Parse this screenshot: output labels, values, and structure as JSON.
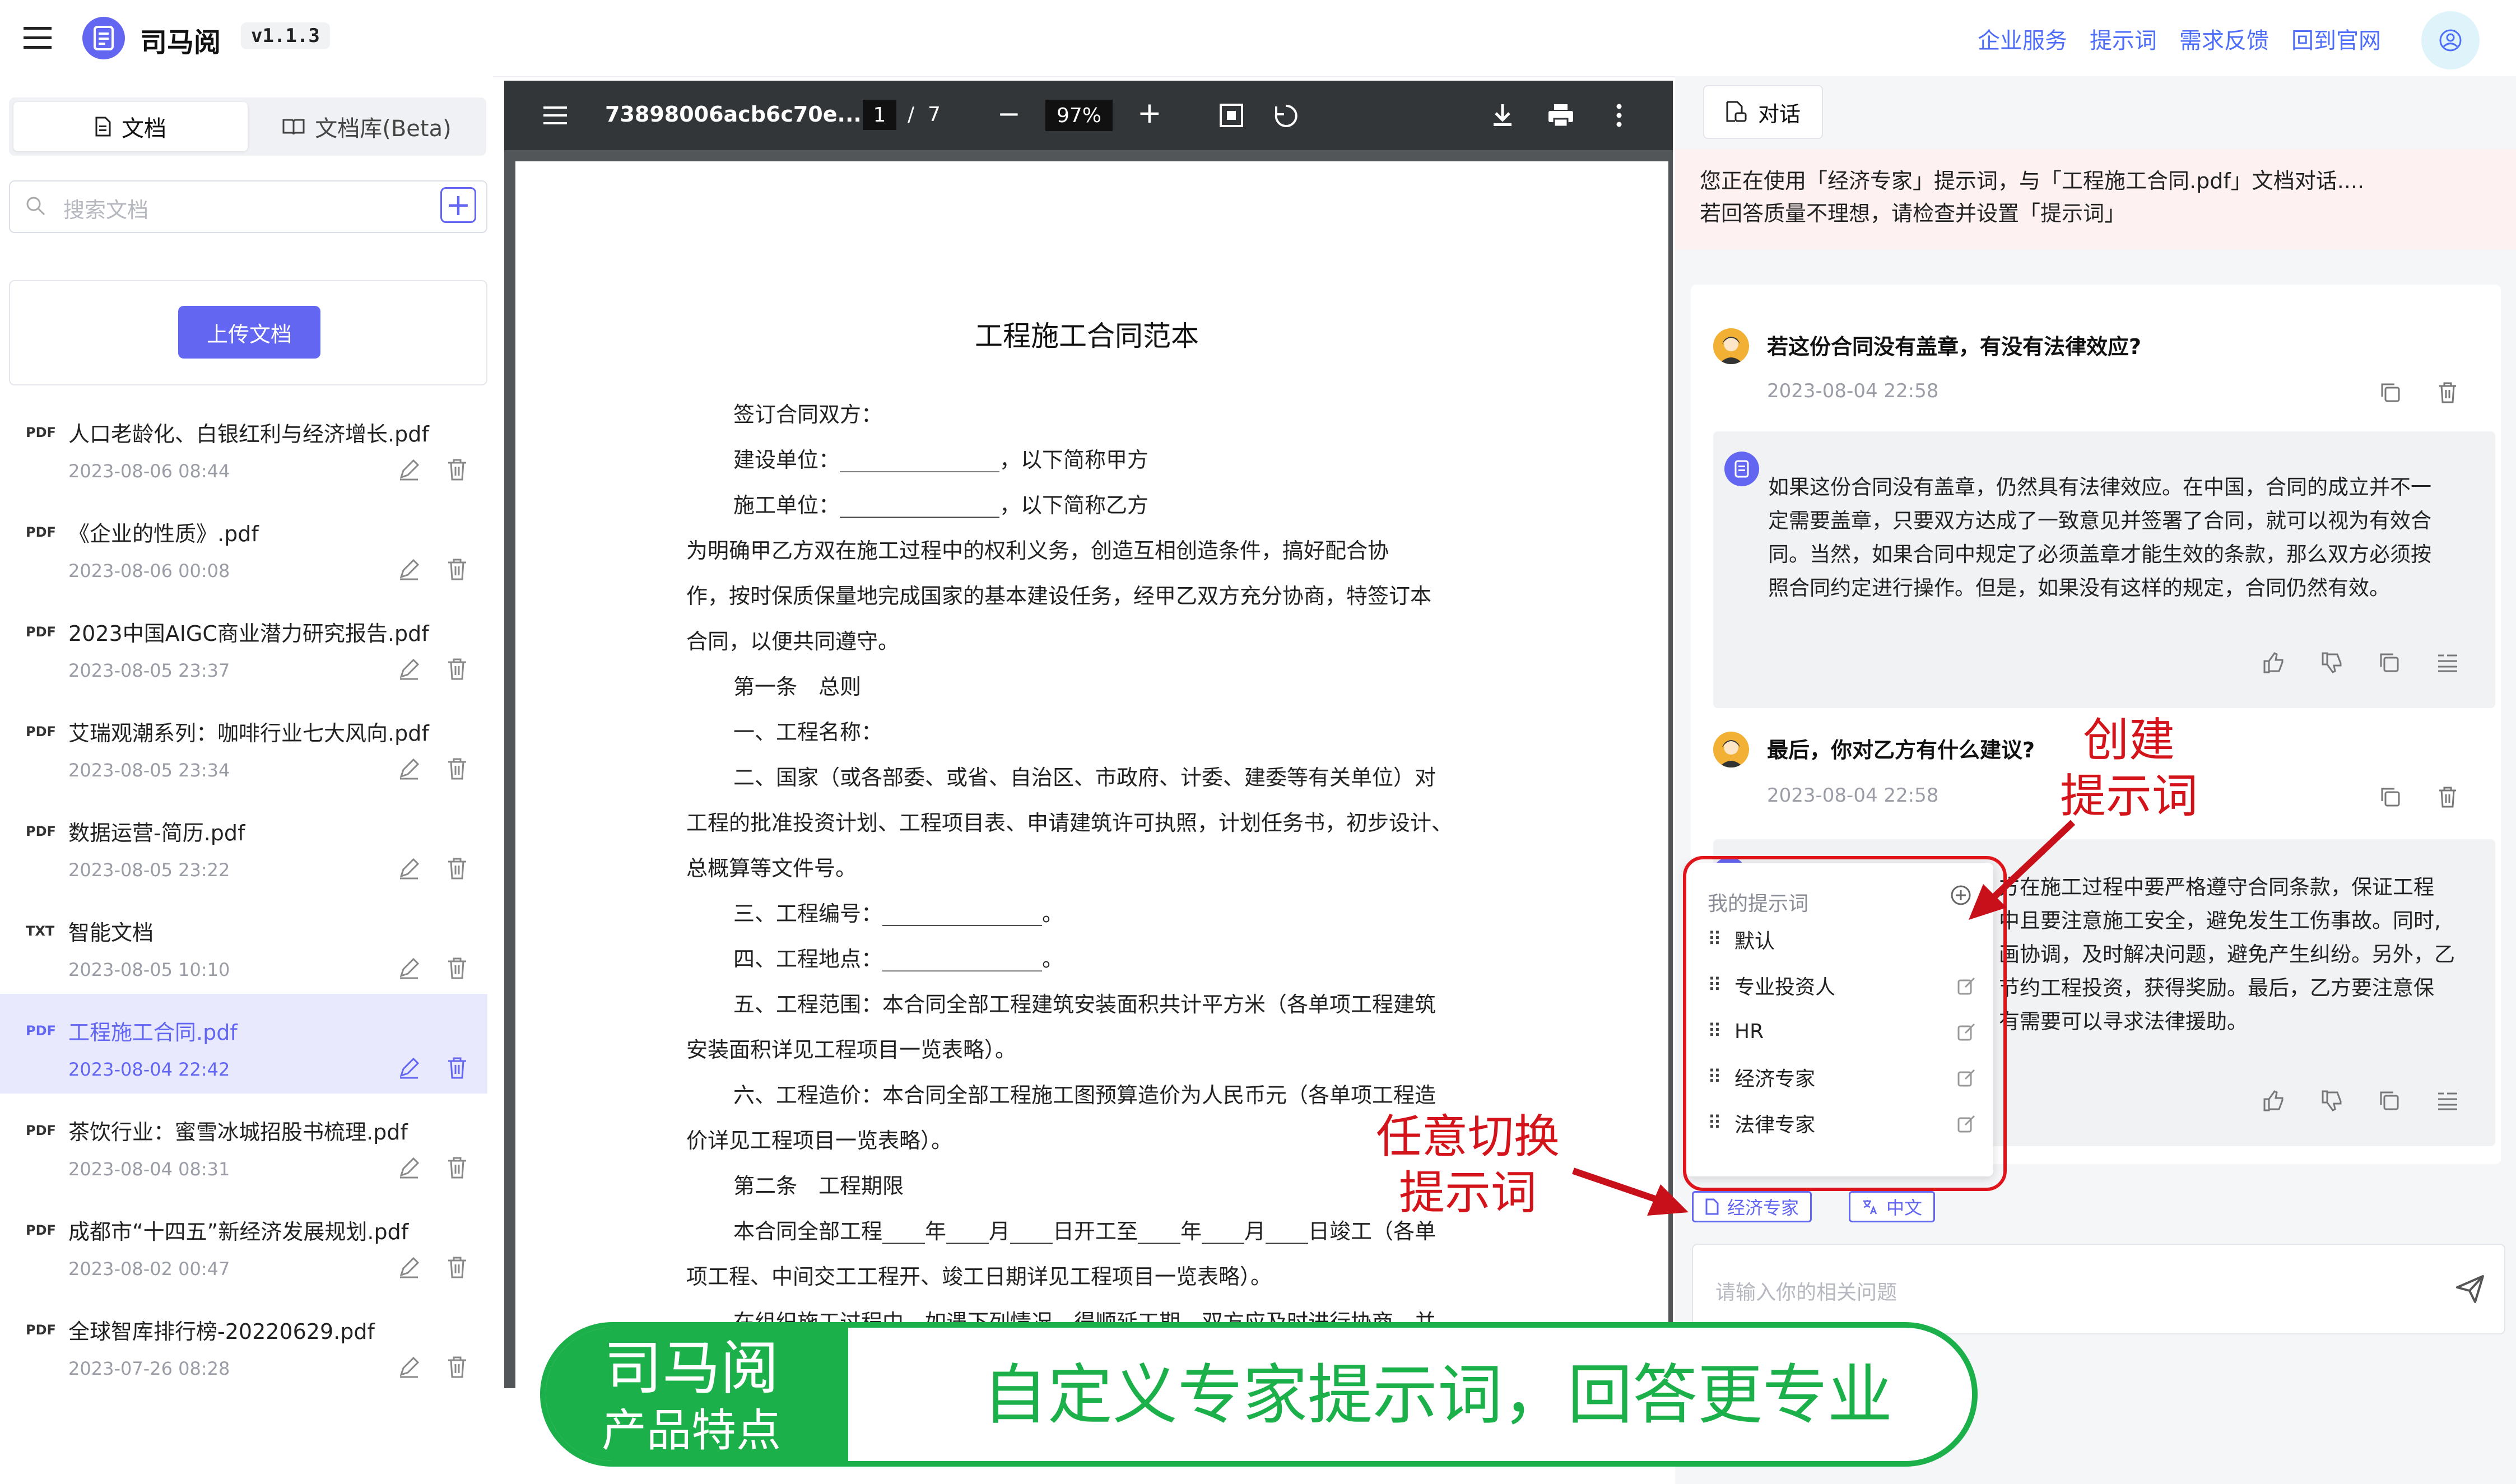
{
  "header": {
    "app_title": "司马阅",
    "version": "v1.1.3",
    "nav": [
      "企业服务",
      "提示词",
      "需求反馈",
      "回到官网"
    ]
  },
  "sidebar": {
    "tabs": [
      {
        "label": "文档",
        "active": true
      },
      {
        "label": "文档库(Beta)",
        "active": false
      }
    ],
    "search_placeholder": "搜索文档",
    "add_label": "+",
    "upload_label": "上传文档",
    "files": [
      {
        "type": "PDF",
        "name": "人口老龄化、白银红利与经济增长.pdf",
        "date": "2023-08-06 08:44",
        "active": false
      },
      {
        "type": "PDF",
        "name": "《企业的性质》.pdf",
        "date": "2023-08-06 00:08",
        "active": false
      },
      {
        "type": "PDF",
        "name": "2023中国AIGC商业潜力研究报告.pdf",
        "date": "2023-08-05 23:37",
        "active": false
      },
      {
        "type": "PDF",
        "name": "艾瑞观潮系列：咖啡行业七大风向.pdf",
        "date": "2023-08-05 23:34",
        "active": false
      },
      {
        "type": "PDF",
        "name": "数据运营-简历.pdf",
        "date": "2023-08-05 23:22",
        "active": false
      },
      {
        "type": "TXT",
        "name": "智能文档",
        "date": "2023-08-05 10:10",
        "active": false
      },
      {
        "type": "PDF",
        "name": "工程施工合同.pdf",
        "date": "2023-08-04 22:42",
        "active": true
      },
      {
        "type": "PDF",
        "name": "茶饮行业：蜜雪冰城招股书梳理.pdf",
        "date": "2023-08-04 08:31",
        "active": false
      },
      {
        "type": "PDF",
        "name": "成都市“十四五”新经济发展规划.pdf",
        "date": "2023-08-02 00:47",
        "active": false
      },
      {
        "type": "PDF",
        "name": "全球智库排行榜-20220629.pdf",
        "date": "2023-07-26 08:28",
        "active": false
      }
    ]
  },
  "pdf": {
    "filename": "73898006acb6c70e...",
    "current_page": "1",
    "page_separator": "/",
    "total_pages": "7",
    "zoom": "97%",
    "title": "工程施工合同范本",
    "lines": [
      {
        "text": "签订合同双方：",
        "indent": true
      },
      {
        "text": "建设单位：_______________，以下简称甲方",
        "indent": true
      },
      {
        "text": "施工单位：_______________，以下简称乙方",
        "indent": true
      },
      {
        "text": "为明确甲乙方双在施工过程中的权利义务，创造互相创造条件，搞好配合协",
        "indent": false
      },
      {
        "text": "作，按时保质保量地完成国家的基本建设任务，经甲乙双方充分协商，特签订本",
        "indent": false
      },
      {
        "text": "合同，以便共同遵守。",
        "indent": false
      },
      {
        "text": "第一条　总则",
        "indent": true
      },
      {
        "text": "一、工程名称：",
        "indent": true
      },
      {
        "text": "二、国家（或各部委、或省、自治区、市政府、计委、建委等有关单位）对",
        "indent": true
      },
      {
        "text": "工程的批准投资计划、工程项目表、申请建筑许可执照，计划任务书，初步设计、",
        "indent": false
      },
      {
        "text": "总概算等文件号。",
        "indent": false
      },
      {
        "text": "三、工程编号：_______________。",
        "indent": true
      },
      {
        "text": "四、工程地点：_______________。",
        "indent": true
      },
      {
        "text": "五、工程范围：本合同全部工程建筑安装面积共计平方米（各单项工程建筑",
        "indent": true
      },
      {
        "text": "安装面积详见工程项目一览表略）。",
        "indent": false
      },
      {
        "text": "六、工程造价：本合同全部工程施工图预算造价为人民币元（各单项工程造",
        "indent": true
      },
      {
        "text": "价详见工程项目一览表略）。",
        "indent": false
      },
      {
        "text": "第二条　工程期限",
        "indent": true
      },
      {
        "text": "本合同全部工程____年____月____日开工至____年____月____日竣工（各单",
        "indent": true
      },
      {
        "text": "项工程、中间交工工程开、竣工日期详见工程项目一览表略）。",
        "indent": false
      },
      {
        "text": "在组织施工过程中，如遇下列情况，得顺延工期，双方应及时进行协商，并",
        "indent": true
      }
    ]
  },
  "chat": {
    "tab_label": "对话",
    "notice_line1": "您正在使用「经济专家」提示词，与「工程施工合同.pdf」文档对话....",
    "notice_line2": "若回答质量不理想，请检查并设置「提示词」",
    "messages": [
      {
        "question": "若这份合同没有盖章，有没有法律效应?",
        "date": "2023-08-04 22:58",
        "answer": [
          "如果这份合同没有盖章，仍然具有法律效应。在中国，合同的成立并不一",
          "定需要盖章，只要双方达成了一致意见并签署了合同，就可以视为有效合",
          "同。当然，如果合同中规定了必须盖章才能生效的条款，那么双方必须按",
          "照合同约定进行操作。但是，如果没有这样的规定，合同仍然有效。"
        ]
      },
      {
        "question": "最后，你对乙方有什么建议?",
        "date": "2023-08-04 22:58",
        "answer": [
          "方在施工过程中要严格遵守合同条款，保证工程",
          "中且要注意施工安全，避免发生工伤事故。同时,",
          "画协调，及时解决问题，避免产生纠纷。另外，乙",
          "节约工程投资，获得奖励。最后，乙方要注意保",
          "有需要可以寻求法律援助。"
        ]
      }
    ],
    "prompt_popup": {
      "header": "我的提示词",
      "items": [
        "默认",
        "专业投资人",
        "HR",
        "经济专家",
        "法律专家"
      ]
    },
    "active_prompt_tag": "经济专家",
    "language_tag": "中文",
    "input_placeholder": "请输入你的相关问题"
  },
  "annotations": {
    "create_prompt": [
      "创建",
      "提示词"
    ],
    "switch_prompt": [
      "任意切换",
      "提示词"
    ]
  },
  "banner": {
    "brand": "司马阅",
    "subtitle": "产品特点",
    "slogan": "自定义专家提示词，回答更专业"
  },
  "colors": {
    "accent": "#6366f1",
    "link": "#4f6ef7",
    "annotation_red": "#e0141b",
    "banner_green": "#1cb04a"
  }
}
